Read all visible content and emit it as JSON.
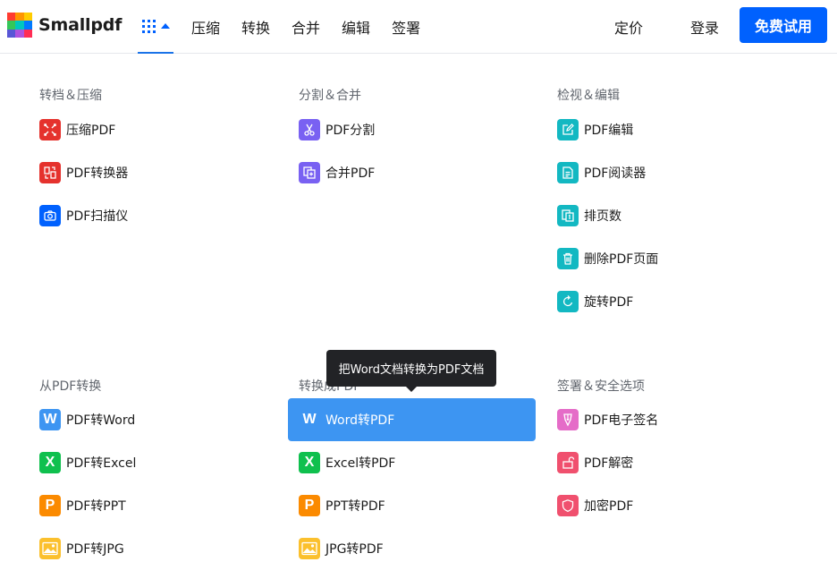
{
  "brand": {
    "name": "Smallpdf",
    "logo_colors": [
      "#ff3b30",
      "#ff9500",
      "#ffcc00",
      "#34c759",
      "#00c7be",
      "#007aff",
      "#5856d6",
      "#af52de",
      "#ff2d55"
    ]
  },
  "header": {
    "apps_icon": "grid-icon",
    "nav": [
      "压缩",
      "转换",
      "合并",
      "编辑",
      "签署"
    ],
    "pricing": "定价",
    "login": "登录",
    "trial": "免费试用"
  },
  "tooltip": "把Word文档转换为PDF文档",
  "sections": [
    {
      "title": "转档＆压缩",
      "tools": [
        {
          "label": "压缩PDF",
          "icon": "compress-icon",
          "color": "#e5322d"
        },
        {
          "label": "PDF转换器",
          "icon": "convert-icon",
          "color": "#e5322d"
        },
        {
          "label": "PDF扫描仪",
          "icon": "camera-icon",
          "color": "#0061fe"
        }
      ]
    },
    {
      "title": "分割＆合并",
      "tools": [
        {
          "label": "PDF分割",
          "icon": "scissors-icon",
          "color": "#7961f2"
        },
        {
          "label": "合并PDF",
          "icon": "merge-icon",
          "color": "#7961f2"
        }
      ]
    },
    {
      "title": "检视＆编辑",
      "tools": [
        {
          "label": "PDF编辑",
          "icon": "edit-icon",
          "color": "#13b8c2"
        },
        {
          "label": "PDF阅读器",
          "icon": "reader-icon",
          "color": "#13b8c2"
        },
        {
          "label": "排页数",
          "icon": "page-number-icon",
          "color": "#13b8c2"
        },
        {
          "label": "删除PDF页面",
          "icon": "trash-icon",
          "color": "#13b8c2"
        },
        {
          "label": "旋转PDF",
          "icon": "rotate-icon",
          "color": "#13b8c2"
        }
      ]
    },
    {
      "title": "从PDF转换",
      "tools": [
        {
          "label": "PDF转Word",
          "icon": "word-icon",
          "color": "#3d95f2"
        },
        {
          "label": "PDF转Excel",
          "icon": "excel-icon",
          "color": "#0fc04e"
        },
        {
          "label": "PDF转PPT",
          "icon": "ppt-icon",
          "color": "#fb8a00"
        },
        {
          "label": "PDF转JPG",
          "icon": "jpg-icon",
          "color": "#fbc02d"
        }
      ]
    },
    {
      "title": "转换成PDF",
      "tools": [
        {
          "label": "Word转PDF",
          "icon": "word-icon",
          "color": "#3d95f2"
        },
        {
          "label": "Excel转PDF",
          "icon": "excel-icon",
          "color": "#0fc04e"
        },
        {
          "label": "PPT转PDF",
          "icon": "ppt-icon",
          "color": "#fb8a00"
        },
        {
          "label": "JPG转PDF",
          "icon": "jpg-icon",
          "color": "#fbc02d"
        }
      ]
    },
    {
      "title": "签署＆安全选项",
      "tools": [
        {
          "label": "PDF电子签名",
          "icon": "sign-icon",
          "color": "#e56cc8"
        },
        {
          "label": "PDF解密",
          "icon": "unlock-icon",
          "color": "#f0506e"
        },
        {
          "label": "加密PDF",
          "icon": "shield-icon",
          "color": "#f0506e"
        }
      ]
    }
  ]
}
